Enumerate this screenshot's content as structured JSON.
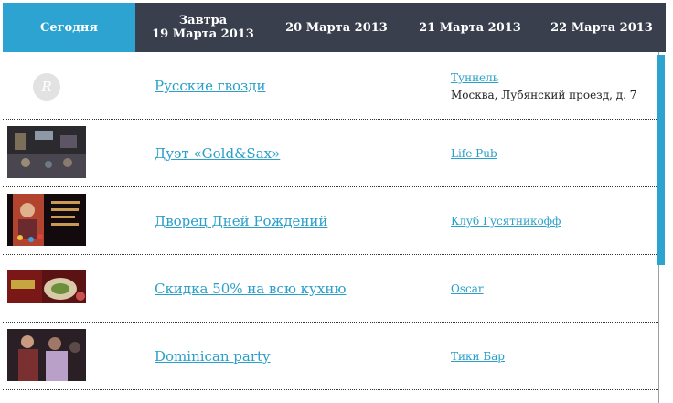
{
  "tabs": [
    {
      "line1": "Сегодня",
      "line2": ""
    },
    {
      "line1": "Завтра",
      "line2": "19 Марта 2013"
    },
    {
      "line1": "20 Марта 2013",
      "line2": ""
    },
    {
      "line1": "21 Марта 2013",
      "line2": ""
    },
    {
      "line1": "22 Марта 2013",
      "line2": ""
    }
  ],
  "events": [
    {
      "title": "Русские гвозди",
      "venue": "Туннель",
      "address": "Москва, Лубянский проезд, д. 7",
      "thumb_letter": "R"
    },
    {
      "title": "Дуэт «Gold&Sax»",
      "venue": "Life Pub",
      "address": ""
    },
    {
      "title": "Дворец Дней Рождений",
      "venue": "Клуб Гусятникофф",
      "address": ""
    },
    {
      "title": "Скидка 50% на всю кухню",
      "venue": "Oscar",
      "address": ""
    },
    {
      "title": "Dominican party",
      "venue": "Тики Бар",
      "address": ""
    }
  ],
  "colors": {
    "accent": "#2ca3d0",
    "header_bg": "#3a3f4d",
    "link": "#2a9fc9"
  }
}
